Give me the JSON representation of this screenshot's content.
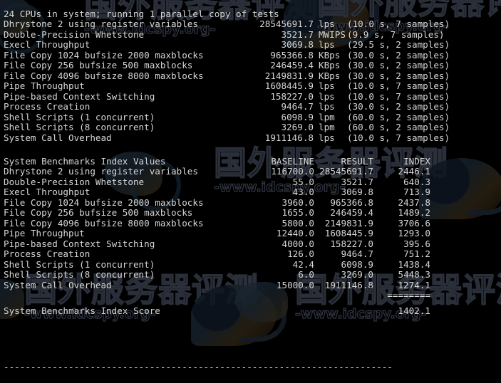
{
  "terminal": {
    "header_line": "24 CPUs in system; running 1 parallel copy of tests",
    "benchmarks": {
      "rows": [
        {
          "label": "Dhrystone 2 using register variables",
          "value": "28545691.7",
          "unit": "lps",
          "detail": "(10.0 s, 7 samples)"
        },
        {
          "label": "Double-Precision Whetstone",
          "value": "3521.7",
          "unit": "MWIPS",
          "detail": "(9.9 s, 7 samples)"
        },
        {
          "label": "Execl Throughput",
          "value": "3069.8",
          "unit": "lps",
          "detail": "(29.5 s, 2 samples)"
        },
        {
          "label": "File Copy 1024 bufsize 2000 maxblocks",
          "value": "965366.8",
          "unit": "KBps",
          "detail": "(30.0 s, 2 samples)"
        },
        {
          "label": "File Copy 256 bufsize 500 maxblocks",
          "value": "246459.4",
          "unit": "KBps",
          "detail": "(30.0 s, 2 samples)"
        },
        {
          "label": "File Copy 4096 bufsize 8000 maxblocks",
          "value": "2149831.9",
          "unit": "KBps",
          "detail": "(30.0 s, 2 samples)"
        },
        {
          "label": "Pipe Throughput",
          "value": "1608445.9",
          "unit": "lps",
          "detail": "(10.0 s, 7 samples)"
        },
        {
          "label": "Pipe-based Context Switching",
          "value": "158227.0",
          "unit": "lps",
          "detail": "(10.0 s, 7 samples)"
        },
        {
          "label": "Process Creation",
          "value": "9464.7",
          "unit": "lps",
          "detail": "(30.0 s, 2 samples)"
        },
        {
          "label": "Shell Scripts (1 concurrent)",
          "value": "6098.9",
          "unit": "lpm",
          "detail": "(60.0 s, 2 samples)"
        },
        {
          "label": "Shell Scripts (8 concurrent)",
          "value": "3269.0",
          "unit": "lpm",
          "detail": "(60.0 s, 2 samples)"
        },
        {
          "label": "System Call Overhead",
          "value": "1911146.8",
          "unit": "lps",
          "detail": "(10.0 s, 7 samples)"
        }
      ]
    },
    "index_table": {
      "title": "System Benchmarks Index Values",
      "columns": {
        "baseline": "BASELINE",
        "result": "RESULT",
        "index": "INDEX"
      },
      "rows": [
        {
          "label": "Dhrystone 2 using register variables",
          "baseline": "116700.0",
          "result": "28545691.7",
          "index": "2446.1"
        },
        {
          "label": "Double-Precision Whetstone",
          "baseline": "55.0",
          "result": "3521.7",
          "index": "640.3"
        },
        {
          "label": "Execl Throughput",
          "baseline": "43.0",
          "result": "3069.8",
          "index": "713.9"
        },
        {
          "label": "File Copy 1024 bufsize 2000 maxblocks",
          "baseline": "3960.0",
          "result": "965366.8",
          "index": "2437.8"
        },
        {
          "label": "File Copy 256 bufsize 500 maxblocks",
          "baseline": "1655.0",
          "result": "246459.4",
          "index": "1489.2"
        },
        {
          "label": "File Copy 4096 bufsize 8000 maxblocks",
          "baseline": "5800.0",
          "result": "2149831.9",
          "index": "3706.6"
        },
        {
          "label": "Pipe Throughput",
          "baseline": "12440.0",
          "result": "1608445.9",
          "index": "1293.0"
        },
        {
          "label": "Pipe-based Context Switching",
          "baseline": "4000.0",
          "result": "158227.0",
          "index": "395.6"
        },
        {
          "label": "Process Creation",
          "baseline": "126.0",
          "result": "9464.7",
          "index": "751.2"
        },
        {
          "label": "Shell Scripts (1 concurrent)",
          "baseline": "42.4",
          "result": "6098.9",
          "index": "1438.4"
        },
        {
          "label": "Shell Scripts (8 concurrent)",
          "baseline": "6.0",
          "result": "3269.0",
          "index": "5448.3"
        },
        {
          "label": "System Call Overhead",
          "baseline": "15000.0",
          "result": "1911146.8",
          "index": "1274.1"
        }
      ],
      "separator": "========",
      "score_label": "System Benchmarks Index Score",
      "score_value": "1402.1"
    },
    "bottom_rule": "------------------------------------------------------------------------",
    "colors": {
      "background": "#000000",
      "foreground": "#d6d6d6",
      "watermark": "#2a2f3a"
    }
  },
  "watermark": {
    "cn_text": "国外服务器评测",
    "url_text": "-www.idcspy.org-"
  }
}
